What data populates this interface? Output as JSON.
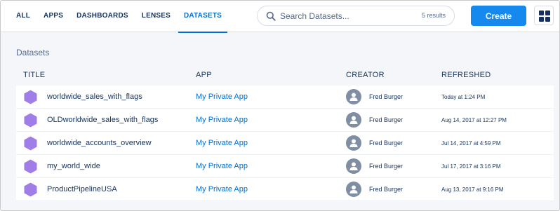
{
  "nav": {
    "tabs": [
      {
        "label": "ALL"
      },
      {
        "label": "APPS"
      },
      {
        "label": "DASHBOARDS"
      },
      {
        "label": "LENSES"
      },
      {
        "label": "DATASETS",
        "active": true
      }
    ]
  },
  "search": {
    "placeholder": "Search Datasets...",
    "result_count": "5 results"
  },
  "toolbar": {
    "create_label": "Create"
  },
  "section": {
    "title": "Datasets"
  },
  "table": {
    "headers": {
      "title": "TITLE",
      "app": "APP",
      "creator": "CREATOR",
      "refreshed": "REFRESHED"
    },
    "rows": [
      {
        "title": "worldwide_sales_with_flags",
        "app": "My Private App",
        "creator": "Fred Burger",
        "refreshed": "Today at 1:24 PM"
      },
      {
        "title": "OLDworldwide_sales_with_flags",
        "app": "My Private App",
        "creator": "Fred Burger",
        "refreshed": "Aug 14, 2017 at 12:27 PM"
      },
      {
        "title": "worldwide_accounts_overview",
        "app": "My Private App",
        "creator": "Fred Burger",
        "refreshed": "Jul 14, 2017 at 4:59 PM"
      },
      {
        "title": "my_world_wide",
        "app": "My Private App",
        "creator": "Fred Burger",
        "refreshed": "Jul 17, 2017 at 3:16 PM"
      },
      {
        "title": "ProductPipelineUSA",
        "app": "My Private App",
        "creator": "Fred Burger",
        "refreshed": "Aug 13, 2017 at 9:16 PM"
      }
    ]
  },
  "colors": {
    "accent": "#0070d2",
    "create_button": "#1589ee",
    "dataset_icon": "#9f7ee7",
    "avatar": "#7f8ea3"
  },
  "icons": {
    "search": "search-icon",
    "grid": "grid-view-icon",
    "dataset": "dataset-hexagon-icon",
    "avatar": "user-avatar-icon"
  }
}
